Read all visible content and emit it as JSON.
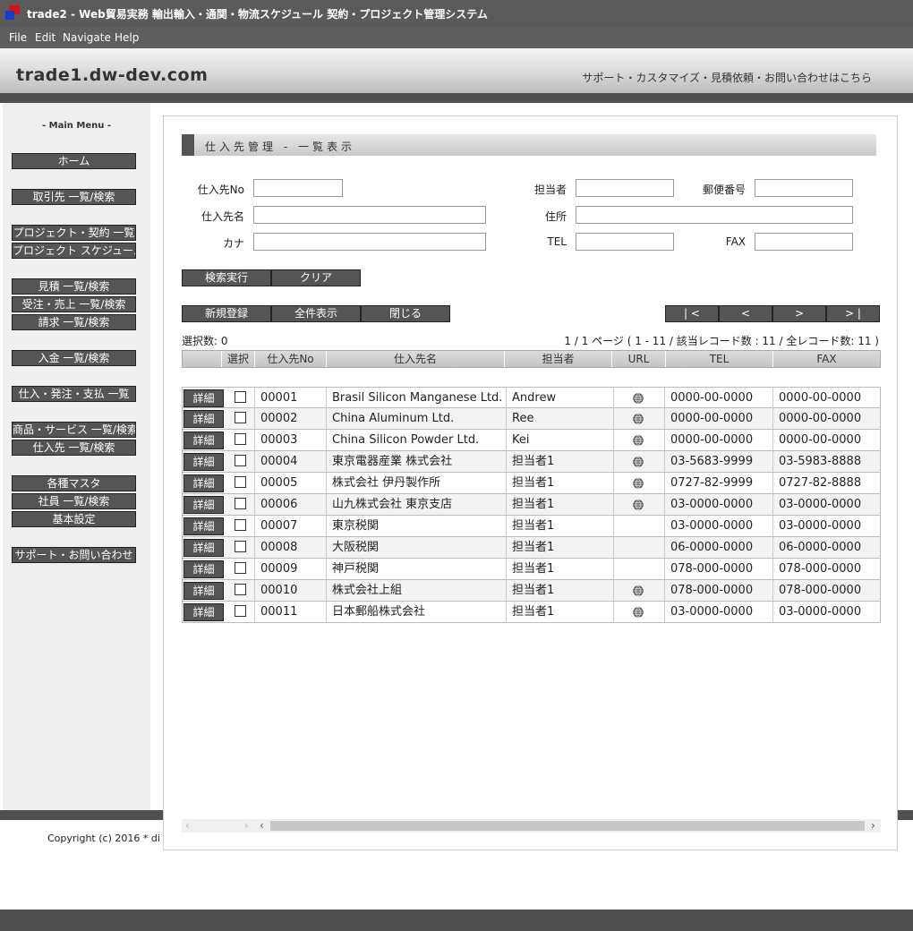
{
  "window": {
    "title": "trade2 - Web貿易実務 輸出輸入・通関・物流スケジュール 契約・プロジェクト管理システム"
  },
  "menubar": {
    "file": "File",
    "edit": "Edit",
    "navigate": "Navigate",
    "help": "Help"
  },
  "header": {
    "site_name": "trade1.dw-dev.com",
    "support_link": "サポート・カスタマイズ・見積依頼・お問い合わせはこちら"
  },
  "sidebar": {
    "title": "- Main Menu -",
    "items": [
      {
        "label": "ホーム"
      },
      {
        "label": "取引先 一覧/検索"
      },
      {
        "label": "プロジェクト・契約 一覧"
      },
      {
        "label": "プロジェクト スケジュール"
      },
      {
        "label": "見積 一覧/検索"
      },
      {
        "label": "受注・売上 一覧/検索"
      },
      {
        "label": "請求 一覧/検索"
      },
      {
        "label": "入金 一覧/検索"
      },
      {
        "label": "仕入・発注・支払 一覧"
      },
      {
        "label": "商品・サービス 一覧/検索"
      },
      {
        "label": "仕入先 一覧/検索"
      },
      {
        "label": "各種マスタ"
      },
      {
        "label": "社員 一覧/検索"
      },
      {
        "label": "基本設定"
      },
      {
        "label": "サポート・お問い合わせ"
      }
    ]
  },
  "page": {
    "title": "仕入先管理 - 一覧表示"
  },
  "search_form": {
    "supplier_no_label": "仕入先No",
    "supplier_name_label": "仕入先名",
    "kana_label": "カナ",
    "contact_label": "担当者",
    "address_label": "住所",
    "tel_label": "TEL",
    "postal_label": "郵便番号",
    "fax_label": "FAX",
    "search_button": "検索実行",
    "clear_button": "クリア"
  },
  "actions": {
    "new_button": "新規登録",
    "show_all_button": "全件表示",
    "close_button": "閉じる",
    "first_page": "| <",
    "prev_page": "<",
    "next_page": ">",
    "last_page": "> |"
  },
  "summary": {
    "selected": "選択数: 0",
    "pagination": "1 / 1 ページ ( 1 - 11 / 該当レコード数 : 11 / 全レコード数: 11 )"
  },
  "table": {
    "headers": [
      "",
      "選択",
      "仕入先No",
      "仕入先名",
      "担当者",
      "URL",
      "TEL",
      "FAX"
    ],
    "detail_label": "詳細",
    "rows": [
      {
        "no": "00001",
        "name": "Brasil Silicon Manganese Ltd.",
        "contact": "Andrew",
        "url": true,
        "tel": "0000-00-0000",
        "fax": "0000-00-0000"
      },
      {
        "no": "00002",
        "name": "China Aluminum Ltd.",
        "contact": "Ree",
        "url": true,
        "tel": "0000-00-0000",
        "fax": "0000-00-0000"
      },
      {
        "no": "00003",
        "name": "China Silicon Powder Ltd.",
        "contact": "Kei",
        "url": true,
        "tel": "0000-00-0000",
        "fax": "0000-00-0000"
      },
      {
        "no": "00004",
        "name": "東京電器産業 株式会社",
        "contact": "担当者1",
        "url": true,
        "tel": "03-5683-9999",
        "fax": "03-5983-8888"
      },
      {
        "no": "00005",
        "name": "株式会社 伊丹製作所",
        "contact": "担当者1",
        "url": true,
        "tel": "0727-82-9999",
        "fax": "0727-82-8888"
      },
      {
        "no": "00006",
        "name": "山九株式会社 東京支店",
        "contact": "担当者1",
        "url": true,
        "tel": "03-0000-0000",
        "fax": "03-0000-0000"
      },
      {
        "no": "00007",
        "name": "東京税関",
        "contact": "担当者1",
        "url": false,
        "tel": "03-0000-0000",
        "fax": "03-0000-0000"
      },
      {
        "no": "00008",
        "name": "大阪税関",
        "contact": "担当者1",
        "url": false,
        "tel": "06-0000-0000",
        "fax": "06-0000-0000"
      },
      {
        "no": "00009",
        "name": "神戸税関",
        "contact": "担当者1",
        "url": false,
        "tel": "078-000-0000",
        "fax": "078-000-0000"
      },
      {
        "no": "00010",
        "name": "株式会社上組",
        "contact": "担当者1",
        "url": true,
        "tel": "078-000-0000",
        "fax": "078-000-0000"
      },
      {
        "no": "00011",
        "name": "日本郵船株式会社",
        "contact": "担当者1",
        "url": true,
        "tel": "03-0000-0000",
        "fax": "03-0000-0000"
      }
    ]
  },
  "footer": {
    "copyright": "Copyright (c) 2016 * di"
  }
}
